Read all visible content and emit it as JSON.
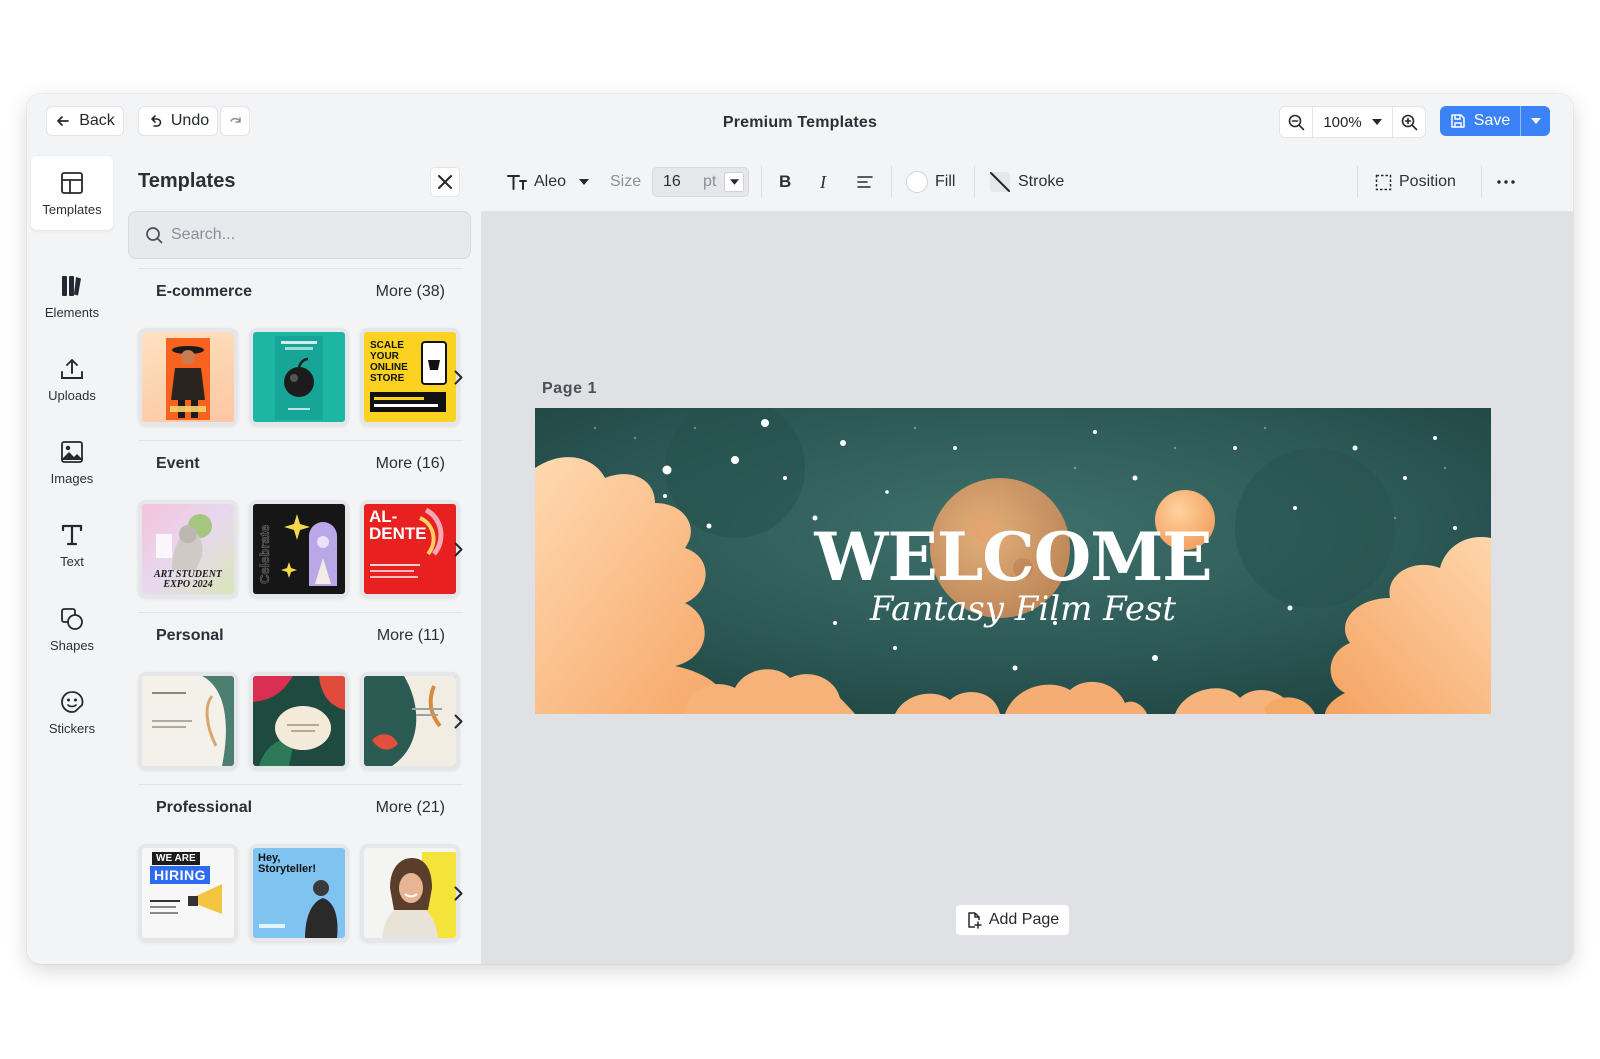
{
  "topbar": {
    "back_label": "Back",
    "undo_label": "Undo",
    "title": "Premium Templates",
    "zoom": "100%",
    "save_label": "Save"
  },
  "rail": {
    "items": [
      {
        "label": "Templates",
        "icon": "templates-icon"
      },
      {
        "label": "Elements",
        "icon": "elements-icon"
      },
      {
        "label": "Uploads",
        "icon": "upload-icon"
      },
      {
        "label": "Images",
        "icon": "image-icon"
      },
      {
        "label": "Text",
        "icon": "text-icon"
      },
      {
        "label": "Shapes",
        "icon": "shapes-icon"
      },
      {
        "label": "Stickers",
        "icon": "sticker-icon"
      }
    ]
  },
  "panel": {
    "title": "Templates",
    "search_placeholder": "Search...",
    "sections": [
      {
        "name": "E-commerce",
        "more": "More (38)"
      },
      {
        "name": "Event",
        "more": "More (16)"
      },
      {
        "name": "Personal",
        "more": "More (11)"
      },
      {
        "name": "Professional",
        "more": "More (21)"
      }
    ],
    "thumb_text": {
      "scale": "SCALE YOUR ONLINE STORE",
      "art": "ART STUDENT EXPO 2024",
      "celebrate": "Celebrate",
      "aldente": "AL-DENTE",
      "hiring_top": "WE ARE",
      "hiring_bottom": "HIRING",
      "storyteller": "Hey, Storyteller!"
    }
  },
  "toolbar": {
    "font": "Aleo",
    "size_label": "Size",
    "size_value": "16",
    "size_unit": "pt",
    "bold": "B",
    "italic": "I",
    "fill_label": "Fill",
    "stroke_label": "Stroke",
    "position_label": "Position"
  },
  "canvas": {
    "page_label": "Page 1",
    "headline": "WELCOME",
    "subtitle": "Fantasy Film Fest",
    "add_page_label": "Add Page"
  },
  "colors": {
    "accent": "#3b82f6",
    "canvas_bg": "#dfe1e4",
    "banner_teal": "#2f5a57",
    "cloud_orange": "#f6b07a"
  }
}
